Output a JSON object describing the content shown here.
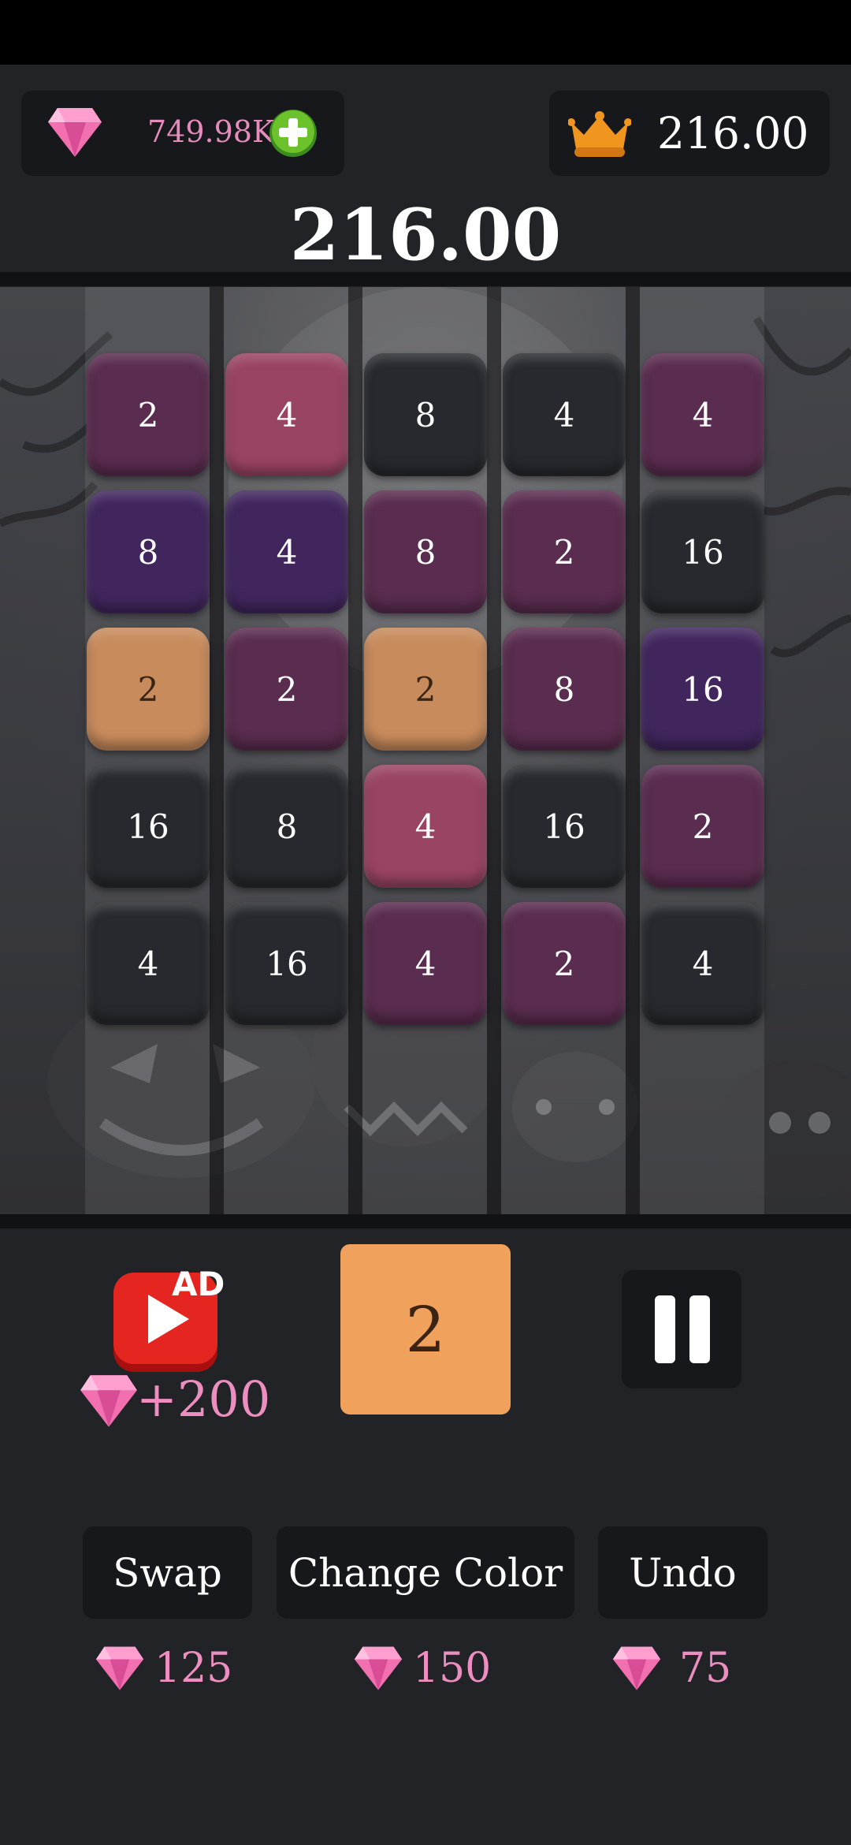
{
  "header": {
    "gems_value": "749.98K",
    "gem_icon": "pink-gem-icon",
    "add_icon": "green-plus-icon",
    "crown_icon": "crown-icon",
    "best_score": "216.00"
  },
  "score": "216.00",
  "board": {
    "columns": 5,
    "tiles": [
      {
        "value": "2",
        "color": "#5a2c4f"
      },
      {
        "value": "4",
        "color": "#9a4463"
      },
      {
        "value": "8",
        "color": "#27292e"
      },
      {
        "value": "4",
        "color": "#27292e"
      },
      {
        "value": "4",
        "color": "#5a2c4f"
      },
      {
        "value": "8",
        "color": "#41265e"
      },
      {
        "value": "4",
        "color": "#41265e"
      },
      {
        "value": "8",
        "color": "#5a2c4f"
      },
      {
        "value": "2",
        "color": "#5a2c4f"
      },
      {
        "value": "16",
        "color": "#27292e"
      },
      {
        "value": "2",
        "color": "#c88b5c"
      },
      {
        "value": "2",
        "color": "#5a2c4f"
      },
      {
        "value": "2",
        "color": "#c88b5c"
      },
      {
        "value": "8",
        "color": "#5a2c4f"
      },
      {
        "value": "16",
        "color": "#41265e"
      },
      {
        "value": "16",
        "color": "#27292e"
      },
      {
        "value": "8",
        "color": "#27292e"
      },
      {
        "value": "4",
        "color": "#9a4463"
      },
      {
        "value": "16",
        "color": "#27292e"
      },
      {
        "value": "2",
        "color": "#5a2c4f"
      },
      {
        "value": "4",
        "color": "#27292e"
      },
      {
        "value": "16",
        "color": "#27292e"
      },
      {
        "value": "4",
        "color": "#5a2c4f"
      },
      {
        "value": "2",
        "color": "#5a2c4f"
      },
      {
        "value": "4",
        "color": "#27292e"
      }
    ]
  },
  "ad": {
    "label": "AD",
    "reward": "+200",
    "icon": "play-video-icon"
  },
  "next_tile": {
    "value": "2",
    "color": "#f0a15c"
  },
  "pause_icon": "pause-icon",
  "powerups": [
    {
      "label": "Swap",
      "cost": "125"
    },
    {
      "label": "Change Color",
      "cost": "150"
    },
    {
      "label": "Undo",
      "cost": "75"
    }
  ]
}
